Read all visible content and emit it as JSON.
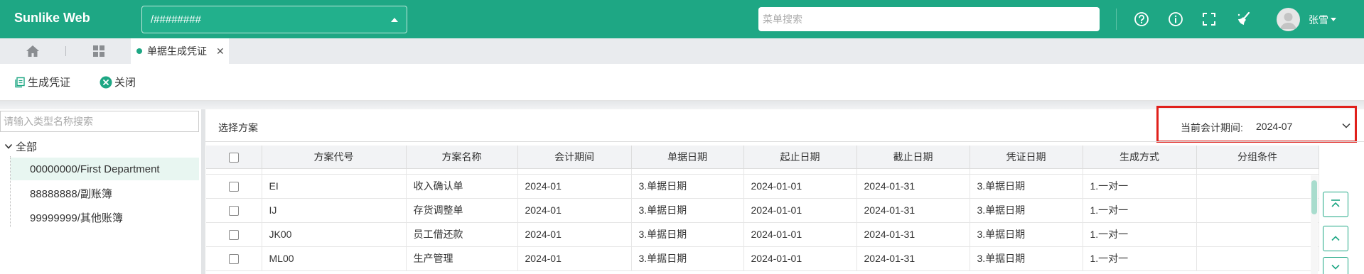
{
  "app": {
    "title": "Sunlike Web"
  },
  "header": {
    "account": "/########",
    "menu_search_placeholder": "菜单搜索",
    "user_name": "张雪"
  },
  "tabs": {
    "active": "单据生成凭证"
  },
  "toolbar": {
    "generate_label": "生成凭证",
    "close_label": "关闭"
  },
  "left": {
    "search_placeholder": "请输入类型名称搜索",
    "root_label": "全部",
    "items": [
      "00000000/First Department",
      "88888888/副账簿",
      "99999999/其他账簿"
    ]
  },
  "main": {
    "scheme_label": "选择方案",
    "period_label": "当前会计期间:",
    "period_value": "2024-07",
    "columns": [
      "方案代号",
      "方案名称",
      "会计期间",
      "单据日期",
      "起止日期",
      "截止日期",
      "凭证日期",
      "生成方式",
      "分组条件"
    ],
    "rows": [
      [
        "EI",
        "收入确认单",
        "2024-01",
        "3.单据日期",
        "2024-01-01",
        "2024-01-31",
        "3.单据日期",
        "1.一对一",
        ""
      ],
      [
        "IJ",
        "存货调整单",
        "2024-01",
        "3.单据日期",
        "2024-01-01",
        "2024-01-31",
        "3.单据日期",
        "1.一对一",
        ""
      ],
      [
        "JK00",
        "员工借还款",
        "2024-01",
        "3.单据日期",
        "2024-01-01",
        "2024-01-31",
        "3.单据日期",
        "1.一对一",
        ""
      ],
      [
        "ML00",
        "生产管理",
        "2024-01",
        "3.单据日期",
        "2024-01-01",
        "2024-01-31",
        "3.单据日期",
        "1.一对一",
        ""
      ]
    ]
  },
  "colors": {
    "brand": "#1ea784",
    "highlight_border": "#e0201b"
  }
}
